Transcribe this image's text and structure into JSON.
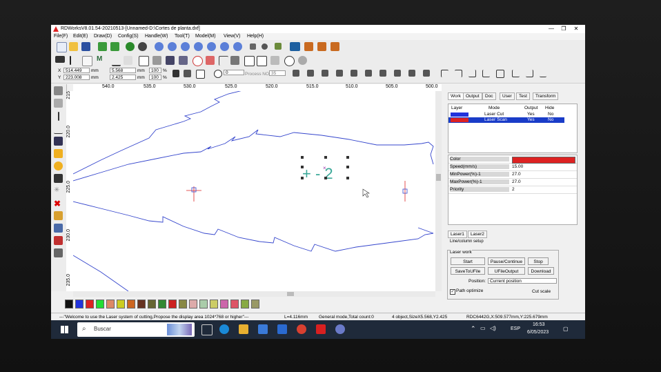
{
  "app": {
    "title": "RDWorksV8.01.54-20210513-[Unnamed-D:\\Cortes de planta.dxf]",
    "minimize": "—",
    "restore": "❐",
    "close": "✕"
  },
  "menu": [
    "File(F)",
    "Edit(E)",
    "Draw(D)",
    "Config(S)",
    "Handle(W)",
    "Tool(T)",
    "Model(M)",
    "View(V)",
    "Help(H)"
  ],
  "coords": {
    "x_label": "X",
    "x_value": "514.449",
    "x_unit": "mm",
    "y_label": "Y",
    "y_value": "223.008",
    "y_unit": "mm",
    "w_value": "5.568",
    "w_unit": "mm",
    "h_value": "2.425",
    "h_unit": "mm",
    "w_pct": "100",
    "h_pct": "100",
    "pct": "%",
    "angle": "0",
    "process_label": "Process NO.",
    "process_no": "35"
  },
  "ruler_h": [
    "540.0",
    "535.0",
    "530.0",
    "525.0",
    "520.0",
    "515.0",
    "510.0",
    "505.0",
    "500.0"
  ],
  "ruler_v": [
    "215",
    "220.0",
    "225.0",
    "230.0",
    "235.0"
  ],
  "palette": [
    "#111111",
    "#2233dd",
    "#dd2222",
    "#22dd33",
    "#dd8866",
    "#cccc22",
    "#cc6622",
    "#663322",
    "#666633",
    "#338833",
    "#cc2222",
    "#888844",
    "#ddaaaa",
    "#aaccaa",
    "#cccc66",
    "#cc66aa",
    "#dd5566",
    "#88aa44",
    "#999966"
  ],
  "status": {
    "welcome": "---\"Welcome to use the Laser system of cutting,Propose the display area 1024*768 or higher\"---",
    "length": "L=4.116mm",
    "mode": "General mode,Total count:0",
    "selection": "4 object,SizeX5.568,Y2.425",
    "device": "RDC6442G,X:509.577mm,Y:225.679mm"
  },
  "right_panel": {
    "tabs": [
      "Work",
      "Output",
      "Doc",
      "User",
      "Test",
      "Transform"
    ],
    "headers": [
      "Layer",
      "Mode",
      "Output",
      "Hide"
    ],
    "layers": [
      {
        "color": "#2233dd",
        "mode": "Laser Cut",
        "output": "Yes",
        "hide": "No",
        "selected": false
      },
      {
        "color": "#dd2222",
        "mode": "Laser Scan",
        "output": "Yes",
        "hide": "No",
        "selected": true
      }
    ],
    "props": [
      {
        "k": "Color",
        "v": ""
      },
      {
        "k": "Speed(mm/s)",
        "v": "15.00"
      },
      {
        "k": "MinPower(%)-1",
        "v": "27.0"
      },
      {
        "k": "MaxPower(%)-1",
        "v": "27.0"
      },
      {
        "k": "Priority",
        "v": "2"
      }
    ],
    "prop_color": "#dd2222",
    "laser_tabs": [
      "Laser1",
      "Laser2"
    ],
    "line_column": "Line/column setup",
    "laser_work": "Laser work",
    "buttons": {
      "start": "Start",
      "pause": "Pause/Continue",
      "stop": "Stop",
      "save": "SaveToUFile",
      "ufile": "UFileOutput",
      "download": "Download"
    },
    "position_label": "Position:",
    "position_value": "Current position",
    "path_optimize": "Path optimize",
    "cut_scale": "Cut scale"
  },
  "taskbar": {
    "search": "Buscar",
    "time": "16:53",
    "date": "6/05/2023",
    "lang": "ESP"
  }
}
